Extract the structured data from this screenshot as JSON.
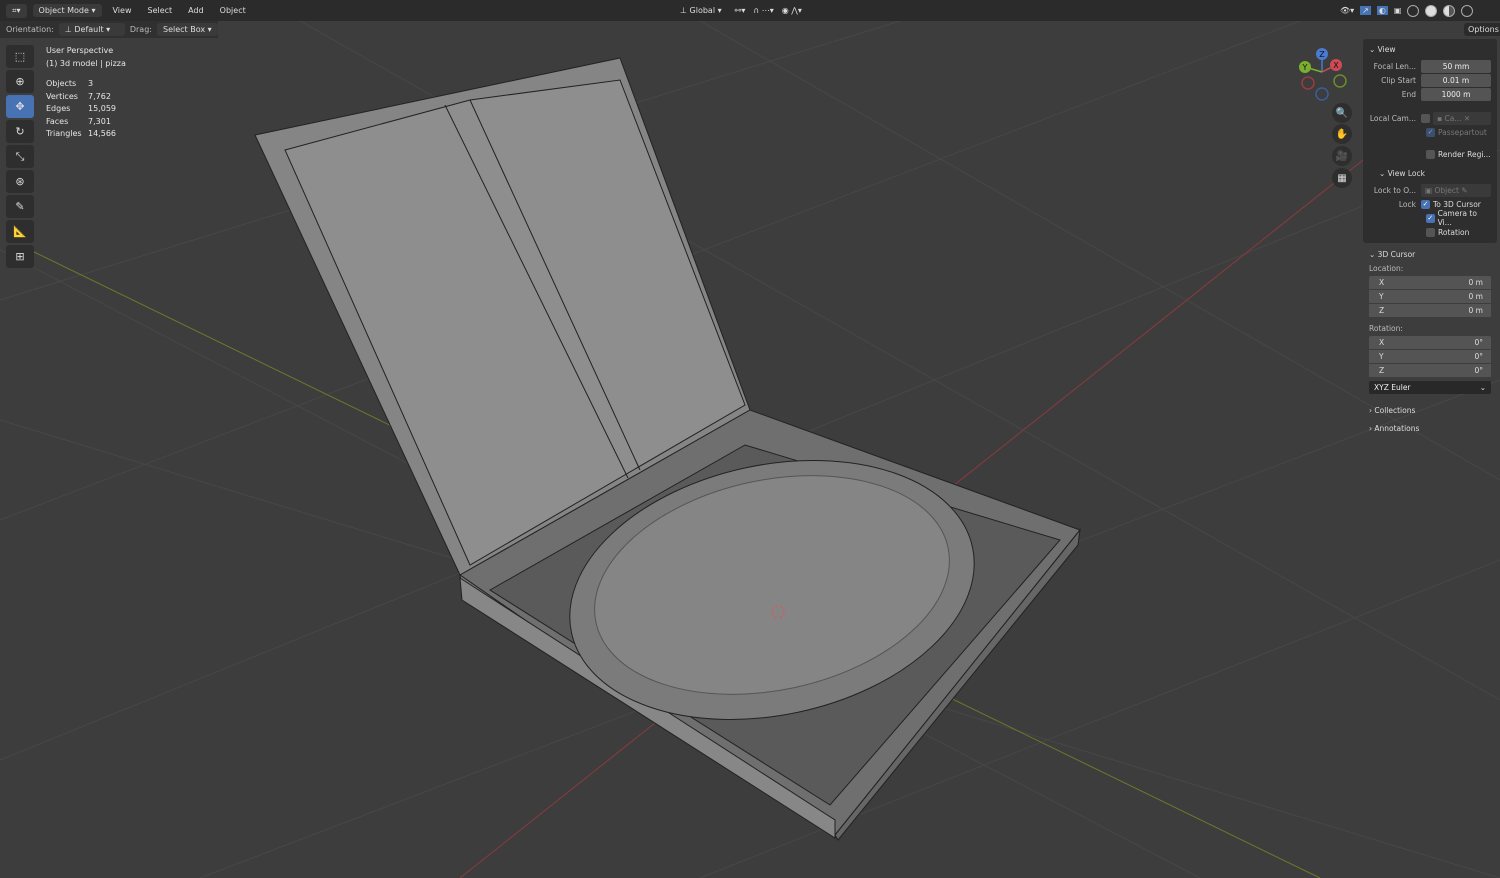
{
  "header": {
    "mode": "Object Mode",
    "menus": [
      "View",
      "Select",
      "Add",
      "Object"
    ],
    "orientation_global": "Global"
  },
  "toolsettings": {
    "orientation_label": "Orientation:",
    "orientation_value": "Default",
    "drag_label": "Drag:",
    "drag_value": "Select Box",
    "options": "Options"
  },
  "overlay": {
    "perspective": "User Perspective",
    "object": "(1) 3d model | pizza",
    "stats": [
      {
        "k": "Objects",
        "v": "3"
      },
      {
        "k": "Vertices",
        "v": "7,762"
      },
      {
        "k": "Edges",
        "v": "15,059"
      },
      {
        "k": "Faces",
        "v": "7,301"
      },
      {
        "k": "Triangles",
        "v": "14,566"
      }
    ]
  },
  "gizmo": {
    "x": "X",
    "y": "Y",
    "z": "Z"
  },
  "npanel": {
    "view": {
      "title": "View",
      "focal_label": "Focal Len...",
      "focal": "50 mm",
      "clip_start_label": "Clip Start",
      "clip_start": "0.01 m",
      "end_label": "End",
      "end": "1000 m",
      "local_cam_label": "Local Cam...",
      "local_cam_value": "Ca...",
      "passepartout": "Passepartout",
      "render_region": "Render Regi..."
    },
    "view_lock": {
      "title": "View Lock",
      "lock_to_label": "Lock to O...",
      "lock_to_placeholder": "Object",
      "lock_label": "Lock",
      "to_cursor": "To 3D Cursor",
      "camera_to_view": "Camera to Vi...",
      "rotation": "Rotation"
    },
    "cursor": {
      "title": "3D Cursor",
      "location_label": "Location:",
      "location": [
        {
          "a": "X",
          "v": "0 m"
        },
        {
          "a": "Y",
          "v": "0 m"
        },
        {
          "a": "Z",
          "v": "0 m"
        }
      ],
      "rotation_label": "Rotation:",
      "rotation": [
        {
          "a": "X",
          "v": "0°"
        },
        {
          "a": "Y",
          "v": "0°"
        },
        {
          "a": "Z",
          "v": "0°"
        }
      ],
      "rotation_mode": "XYZ Euler"
    },
    "collections": "Collections",
    "annotations": "Annotations"
  }
}
